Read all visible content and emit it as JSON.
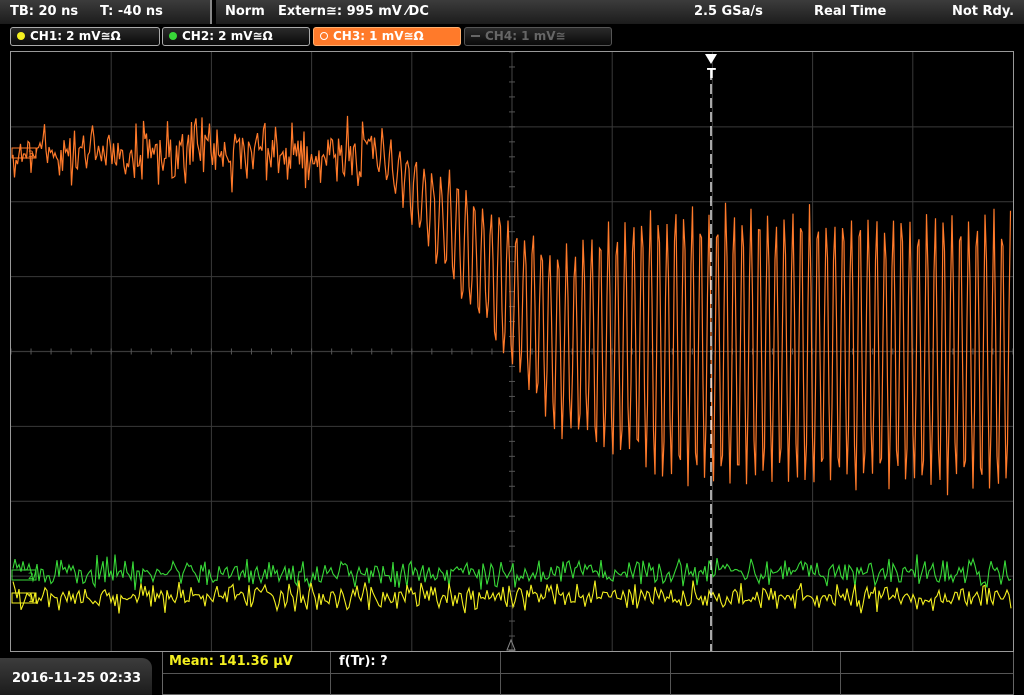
{
  "header": {
    "timebase": "TB: 20 ns",
    "trigger_time": "T: -40 ns",
    "trigger_mode": "Norm",
    "trigger_source": "Extern≅: 995 mV ⁄DC",
    "sample_rate": "2.5 GSa/s",
    "acq_mode": "Real Time",
    "status": "Not Rdy."
  },
  "channels": [
    {
      "label": "CH1: 2 mV≅Ω",
      "color": "#f4f020",
      "state": "on"
    },
    {
      "label": "CH2: 2 mV≅Ω",
      "color": "#38d838",
      "state": "on"
    },
    {
      "label": "CH3: 1 mV≅Ω",
      "color": "#ff7a2a",
      "state": "selected"
    },
    {
      "label": "CH4: 1 mV≅",
      "color": "#555555",
      "state": "off"
    }
  ],
  "colors": {
    "ch1": "#f4f020",
    "ch2": "#38d838",
    "ch3": "#ff7a2a",
    "grid": "#3a3a3a",
    "trigger_marker": "#ffffff"
  },
  "marker_labels": {
    "trigger": "T",
    "ch3": "3",
    "ch2": "2",
    "ch1": "1"
  },
  "footer": {
    "datetime": "2016-11-25 02:33",
    "mean": "Mean: 141.36 µV",
    "rise_freq": "f(Tr): ?"
  }
}
